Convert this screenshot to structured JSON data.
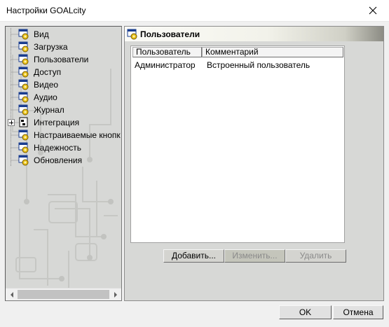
{
  "window": {
    "title": "Настройки GOALcity"
  },
  "tree": {
    "items": [
      {
        "label": "Вид",
        "expandable": false
      },
      {
        "label": "Загрузка",
        "expandable": false
      },
      {
        "label": "Пользователи",
        "expandable": false
      },
      {
        "label": "Доступ",
        "expandable": false
      },
      {
        "label": "Видео",
        "expandable": false
      },
      {
        "label": "Аудио",
        "expandable": false
      },
      {
        "label": "Журнал",
        "expandable": false
      },
      {
        "label": "Интеграция",
        "expandable": true
      },
      {
        "label": "Настраиваемые кнопк",
        "expandable": false
      },
      {
        "label": "Надежность",
        "expandable": false
      },
      {
        "label": "Обновления",
        "expandable": false
      }
    ]
  },
  "panel": {
    "title": "Пользователи",
    "columns": [
      "Пользователь",
      "Комментарий"
    ],
    "rows": [
      [
        "Администратор",
        "Встроенный пользователь"
      ]
    ],
    "buttons": {
      "add": "Добавить...",
      "edit": "Изменить...",
      "delete": "Удалить"
    }
  },
  "footer": {
    "ok": "OK",
    "cancel": "Отмена"
  },
  "icons": {
    "close": "close-icon",
    "settings": "gear-window-icon",
    "integration": "node-icon"
  }
}
